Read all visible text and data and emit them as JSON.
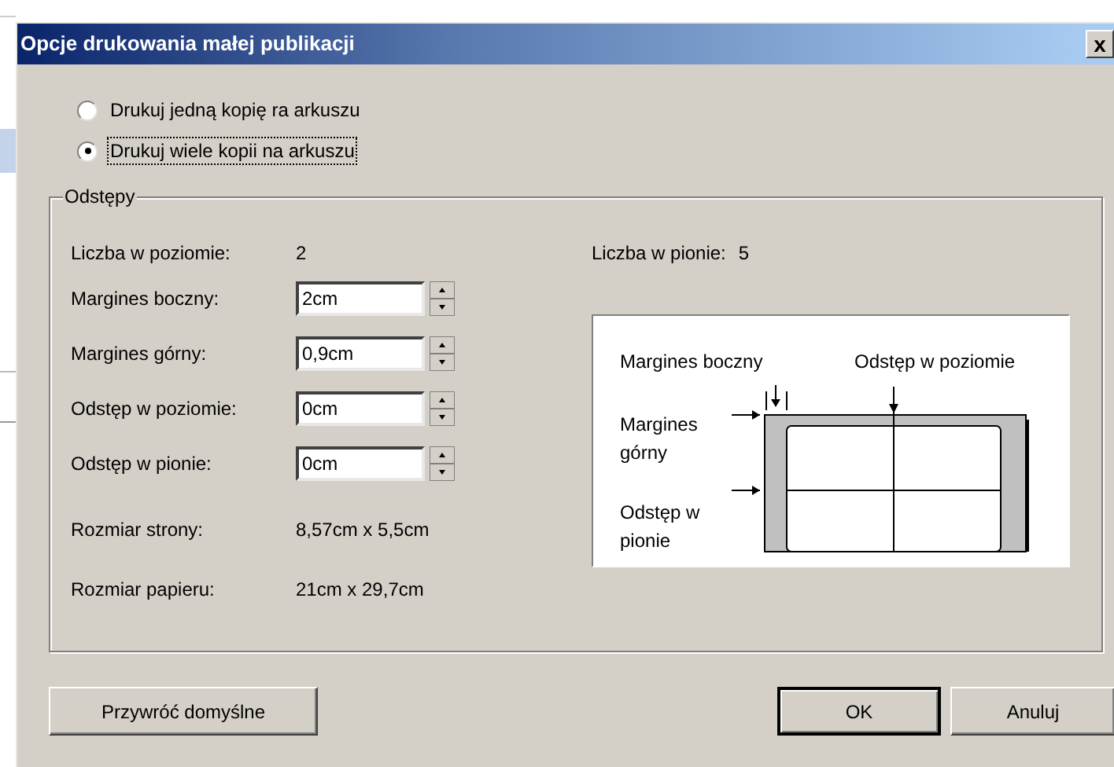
{
  "window": {
    "title": "Opcje drukowania małej publikacji",
    "close": "x"
  },
  "print_options": [
    {
      "label": "Drukuj jedną kopię ra arkuszu",
      "selected": false,
      "focused": false
    },
    {
      "label": "Drukuj wiele kopii na arkuszu",
      "selected": true,
      "focused": true
    }
  ],
  "spacing_group": {
    "title": "Odstępy",
    "count_horizontal": {
      "label": "Liczba w poziomie:",
      "value": "2"
    },
    "count_vertical": {
      "label": "Liczba w pionie:",
      "value": "5"
    },
    "fields": [
      {
        "label": "Margines boczny:",
        "value": "2cm"
      },
      {
        "label": "Margines górny:",
        "value": "0,9cm"
      },
      {
        "label": "Odstęp w poziomie:",
        "value": "0cm"
      },
      {
        "label": "Odstęp w pionie:",
        "value": "0cm"
      }
    ],
    "info": [
      {
        "label": "Rozmiar strony:",
        "value": "8,57cm x 5,5cm"
      },
      {
        "label": "Rozmiar papieru:",
        "value": "21cm x 29,7cm"
      }
    ],
    "diagram": {
      "side_margin": "Margines boczny",
      "horizontal_gap": "Odstęp w poziomie",
      "top_margin": [
        "Margines",
        "górny"
      ],
      "vertical_gap": [
        "Odstęp w",
        "pionie"
      ]
    }
  },
  "buttons": [
    {
      "label": "Przywróć domyślne",
      "default": false
    },
    {
      "label": "OK",
      "default": true
    },
    {
      "label": "Anuluj",
      "default": false
    }
  ]
}
